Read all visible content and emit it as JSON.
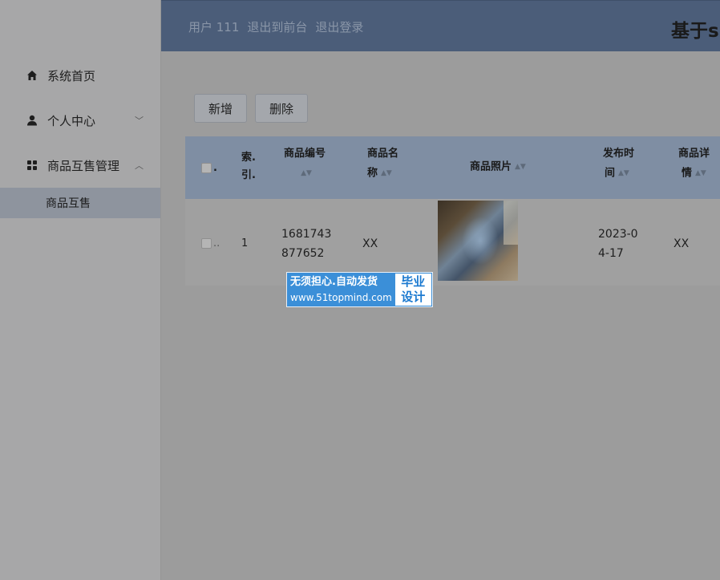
{
  "header": {
    "user_label": "用户 111",
    "exit_front_label": "退出到前台",
    "logout_label": "退出登录",
    "title": "基于s"
  },
  "sidebar": {
    "items": [
      {
        "label": "系统首页",
        "icon": "home-icon"
      },
      {
        "label": "个人中心",
        "icon": "user-icon",
        "arrow": "﹀"
      },
      {
        "label": "商品互售管理",
        "icon": "grid-icon",
        "arrow": "︿"
      }
    ],
    "submenu": {
      "label": "商品互售"
    }
  },
  "toolbar": {
    "add_label": "新增",
    "delete_label": "删除"
  },
  "table": {
    "select_all_label": ".",
    "columns": {
      "index": [
        "索.",
        "引."
      ],
      "product_no": "商品编号",
      "product_name": [
        "商品名",
        "称"
      ],
      "product_photo": "商品照片",
      "publish_time": [
        "发布时",
        "间"
      ],
      "product_detail": [
        "商品详",
        "情"
      ]
    },
    "rows": [
      {
        "index": "1",
        "product_no": [
          "1681743",
          "877652"
        ],
        "product_name": "XX",
        "publish_time": [
          "2023-0",
          "4-17"
        ],
        "product_detail": "XX"
      }
    ]
  },
  "watermark": {
    "line1": "无须担心.自动发货",
    "line2": "www.51topmind.com",
    "right_top": "毕业",
    "right_bottom": "设计"
  },
  "colors": {
    "header_bg": "#4b5d79",
    "table_head_bg": "#7f8ea3",
    "submenu_active_bg": "#8e949e",
    "badge_blue": "#3b8fd8"
  }
}
